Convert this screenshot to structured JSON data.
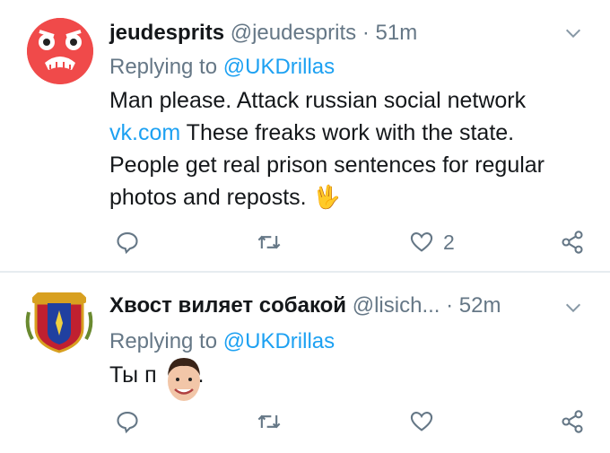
{
  "tweets": [
    {
      "display_name": "jeudesprits",
      "handle": "@jeudesprits",
      "separator": "·",
      "time": "51m",
      "replying_to_prefix": "Replying to",
      "replying_to_user": "@UKDrillas",
      "body_line1": "Man please. Attack russian social network",
      "body_link": "vk.com",
      "body_line2": " These freaks work with the state.",
      "body_line3": "People get real prison sentences for regular",
      "body_line4": "photos and reposts.",
      "body_emoji": "🖖",
      "like_count": "2",
      "avatar_text": "ಠ益ಠ"
    },
    {
      "display_name": "Хвост виляет собакой",
      "handle": "@lisich...",
      "separator": "·",
      "time": "52m",
      "replying_to_prefix": "Replying to",
      "replying_to_user": "@UKDrillas",
      "body_part1": "Ты п",
      "body_part2": "р.",
      "like_count": ""
    }
  ],
  "colors": {
    "text": "#14171a",
    "secondary": "#657786",
    "link": "#1da1f2",
    "separator": "#e6ecf0",
    "avatar_red": "#f04a4a"
  },
  "icons": [
    "chevron-down-icon",
    "reply-icon",
    "retweet-icon",
    "like-icon",
    "share-icon"
  ]
}
